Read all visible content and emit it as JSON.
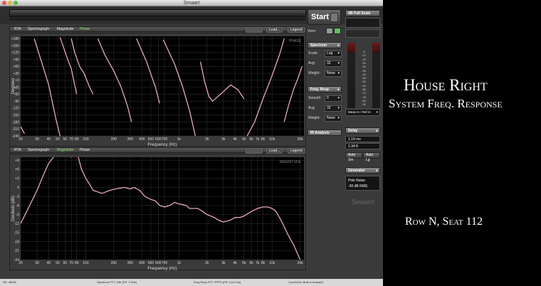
{
  "window": {
    "title": "Smaart"
  },
  "top_tabs": {
    "rta": "RTA",
    "spectrograph": "Spectrograph",
    "magnitude": "Magnitude",
    "phase": "Phase",
    "load": "Load...",
    "legend": "Legend"
  },
  "bottom_tabs": {
    "rta": "RTA",
    "spectrograph": "Spectrograph",
    "magnitude": "Magnitude",
    "phase": "Phase",
    "load": "Load...",
    "legend": "Legend"
  },
  "phase_plot": {
    "label": "PHASE",
    "ylabel": "Degrees",
    "xlabel": "Frequency (Hz)",
    "yticks": [
      "+180",
      "+150",
      "+120",
      "+90",
      "+60",
      "+30",
      "+0",
      "-30",
      "-60",
      "-90",
      "-120",
      "-150",
      "-180",
      "-210",
      "-240"
    ],
    "xticks": [
      "20",
      "30",
      "40",
      "50",
      "60",
      "70",
      "80",
      "100",
      "200",
      "300",
      "400",
      "500",
      "600",
      "700",
      "1k",
      "2k",
      "3k",
      "4k",
      "5k",
      "6k",
      "7k",
      "8k",
      "10k",
      "20k"
    ]
  },
  "magnitude_plot": {
    "label": "MAGNITUDE",
    "ylabel": "Decibels (dB)",
    "xlabel": "Frequency (Hz)",
    "yticks": [
      "+9",
      "+6",
      "+3",
      "0",
      "-3",
      "-6",
      "-9",
      "-12",
      "-15",
      "-18",
      "-21",
      "-24"
    ],
    "xticks": [
      "20",
      "30",
      "40",
      "50",
      "60",
      "70",
      "80",
      "100",
      "200",
      "300",
      "400",
      "500",
      "600",
      "700",
      "1k",
      "2k",
      "3k",
      "4k",
      "5k",
      "6k",
      "7k",
      "8k",
      "10k",
      "20k"
    ]
  },
  "chart_data": [
    {
      "type": "line",
      "title": "",
      "xlabel": "Frequency (Hz)",
      "ylabel": "Degrees",
      "xscale": "log",
      "xlim": [
        20,
        22000
      ],
      "ylim": [
        -240,
        190
      ],
      "grid": true,
      "series": [
        {
          "color": "#e8a6c8",
          "segments": [
            [
              [
                20,
                -200
              ],
              [
                22,
                -230
              ]
            ],
            [
              [
                28,
                180
              ],
              [
                36,
                40
              ],
              [
                40,
                -20
              ],
              [
                48,
                -170
              ],
              [
                53,
                -240
              ]
            ],
            [
              [
                53,
                185
              ],
              [
                64,
                90
              ],
              [
                70,
                50
              ],
              [
                76,
                -20
              ],
              [
                80,
                -60
              ]
            ],
            [
              [
                70,
                180
              ],
              [
                76,
                120
              ],
              [
                86,
                60
              ],
              [
                96,
                30
              ],
              [
                110,
                -30
              ],
              [
                120,
                -60
              ]
            ],
            [
              [
                135,
                180
              ],
              [
                160,
                110
              ],
              [
                200,
                40
              ],
              [
                240,
                -30
              ],
              [
                280,
                -110
              ],
              [
                310,
                -180
              ]
            ],
            [
              [
                350,
                180
              ],
              [
                450,
                80
              ],
              [
                560,
                -30
              ],
              [
                620,
                -100
              ]
            ],
            [
              [
                680,
                175
              ],
              [
                900,
                70
              ],
              [
                1100,
                -30
              ],
              [
                1300,
                -130
              ],
              [
                1500,
                -240
              ]
            ],
            [
              [
                1700,
                80
              ],
              [
                1900,
                -10
              ],
              [
                2100,
                -70
              ],
              [
                2300,
                -90
              ],
              [
                2800,
                -60
              ],
              [
                3600,
                -20
              ],
              [
                4300,
                -40
              ],
              [
                5000,
                -80
              ]
            ],
            [
              [
                5400,
                -240
              ],
              [
                6500,
                -180
              ],
              [
                8000,
                -80
              ],
              [
                10000,
                20
              ],
              [
                12000,
                110
              ],
              [
                13500,
                180
              ]
            ],
            [
              [
                13500,
                -180
              ],
              [
                15000,
                -110
              ],
              [
                17000,
                -40
              ],
              [
                19000,
                10
              ],
              [
                21000,
                60
              ]
            ]
          ]
        }
      ]
    },
    {
      "type": "line",
      "title": "",
      "xlabel": "Frequency (Hz)",
      "ylabel": "Decibels (dB)",
      "xscale": "log",
      "xlim": [
        20,
        22000
      ],
      "ylim": [
        -24,
        10
      ],
      "grid": true,
      "series": [
        {
          "color": "#e8a6c8",
          "points": [
            [
              20,
              -12
            ],
            [
              25,
              -6
            ],
            [
              30,
              -1
            ],
            [
              35,
              4
            ],
            [
              40,
              8
            ],
            [
              45,
              10
            ],
            [
              50,
              12
            ],
            [
              60,
              14
            ],
            [
              70,
              10
            ],
            [
              80,
              12
            ],
            [
              90,
              6
            ],
            [
              100,
              3
            ],
            [
              110,
              1
            ],
            [
              120,
              -1
            ],
            [
              150,
              -2
            ],
            [
              180,
              -1
            ],
            [
              210,
              -0.5
            ],
            [
              260,
              0
            ],
            [
              300,
              -0.5
            ],
            [
              330,
              0
            ],
            [
              380,
              -1
            ],
            [
              430,
              -3
            ],
            [
              500,
              -4
            ],
            [
              560,
              -4.5
            ],
            [
              620,
              -6
            ],
            [
              700,
              -6.5
            ],
            [
              800,
              -6
            ],
            [
              900,
              -5
            ],
            [
              1000,
              -5.5
            ],
            [
              1200,
              -6
            ],
            [
              1300,
              -7
            ],
            [
              1600,
              -7
            ],
            [
              1800,
              -8
            ],
            [
              2000,
              -9
            ],
            [
              2400,
              -10
            ],
            [
              2700,
              -11
            ],
            [
              3000,
              -11.5
            ],
            [
              3500,
              -11
            ],
            [
              4000,
              -10
            ],
            [
              4500,
              -10
            ],
            [
              5000,
              -9.5
            ],
            [
              6000,
              -8
            ],
            [
              7000,
              -7
            ],
            [
              8000,
              -6.5
            ],
            [
              9000,
              -6.5
            ],
            [
              10000,
              -7
            ],
            [
              11000,
              -8
            ],
            [
              12000,
              -10
            ],
            [
              13000,
              -12
            ],
            [
              15000,
              -16
            ],
            [
              17000,
              -19
            ],
            [
              20000,
              -24
            ]
          ]
        }
      ]
    }
  ],
  "right": {
    "start": "Start",
    "view": "View:",
    "db_full_scale": "dB Full Scale",
    "spectrum": {
      "title": "Spectrum",
      "scale_label": "Scale:",
      "scale_value": "Log",
      "avg_label": "Avg:",
      "avg_value": "32",
      "weight_label": "Weight:",
      "weight_value": "None"
    },
    "freq_resp": {
      "title": "Freq. Resp.",
      "smooth_label": "Smooth:",
      "smooth_value": "0",
      "avg_label": "Avg:",
      "avg_value": "32",
      "weight_label": "Weight:",
      "weight_value": "None"
    },
    "ir_analysis": "IR Analysis",
    "meas_ref": "Meas In / Ref In",
    "level_ticks": [
      "-6",
      "-12",
      "-18",
      "-24",
      "-30",
      "-36",
      "-42",
      "-48",
      "-54",
      "-60",
      "-66",
      "-72",
      "-78",
      "-84",
      "-90"
    ],
    "delay": {
      "title": "Delay",
      "ms": "1.19 ms",
      "ft": "1.34 ft",
      "auto_sm": "Auto Sm",
      "auto_lg": "Auto Lg"
    },
    "generator": {
      "title": "Generator",
      "signal": "Pink Noise",
      "level": "-30 dB  RMS"
    },
    "watermark": "Smaart"
  },
  "status": {
    "sr": "SR: 48000",
    "spectrum_fft": "Spectrum FFT: 16K (FR: 2.9Hz)",
    "freq_resp_fft": "Freq Resp FFT: FPPO (FR: 1/24 Oct)",
    "coreout": "CoreInOut: Built-in Audio(0)"
  },
  "captions": {
    "title": "House Right",
    "subtitle": "System Freq. Response",
    "seat": "Row N, Seat 112"
  }
}
